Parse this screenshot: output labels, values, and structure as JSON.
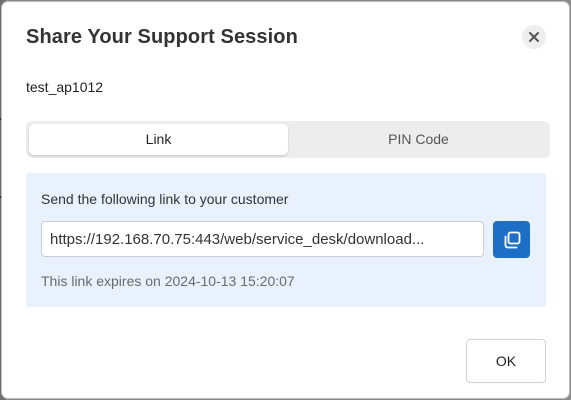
{
  "dialog": {
    "title": "Share Your Support Session",
    "session_name": "test_ap1012",
    "close_icon": "close-icon"
  },
  "tabs": [
    {
      "label": "Link",
      "active": true
    },
    {
      "label": "PIN Code",
      "active": false
    }
  ],
  "link_panel": {
    "instruction": "Send the following link to your customer",
    "link_value": "https://192.168.70.75:443/web/service_desk/download...",
    "copy_icon": "copy-icon",
    "expiry_text": "This link expires on 2024-10-13 15:20:07"
  },
  "footer": {
    "ok_label": "OK"
  },
  "colors": {
    "accent": "#1d6fc6",
    "panel_bg": "#e8f1fc",
    "tab_bar_bg": "#ededed"
  }
}
